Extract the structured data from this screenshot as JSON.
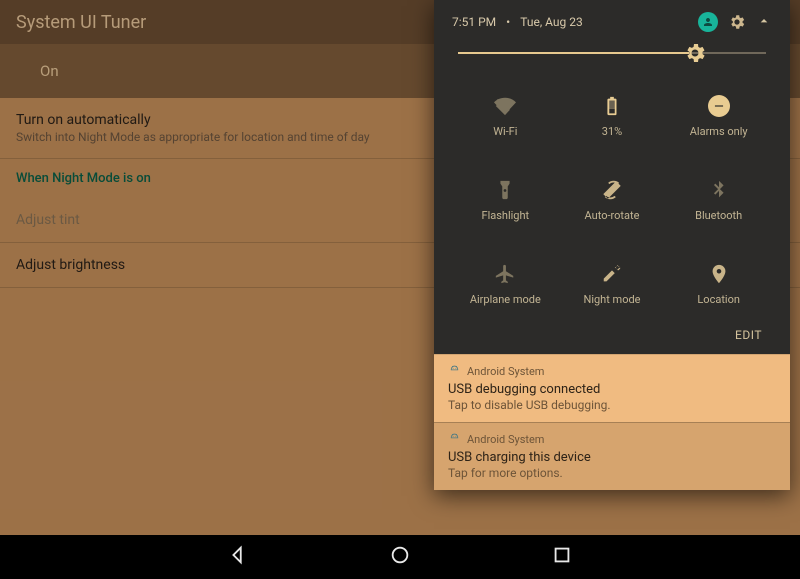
{
  "page": {
    "title": "System UI Tuner",
    "master_switch": "On",
    "items": {
      "auto": {
        "title": "Turn on automatically",
        "subtitle": "Switch into Night Mode as appropriate for location and time of day"
      },
      "section": "When Night Mode is on",
      "tint": {
        "title": "Adjust tint"
      },
      "brightness": {
        "title": "Adjust brightness"
      }
    }
  },
  "shade": {
    "time": "7:51 PM",
    "date": "Tue, Aug 23",
    "separator": "•",
    "brightness_pct": 75,
    "tiles": {
      "wifi": {
        "label": "Wi-Fi"
      },
      "battery": {
        "label": "31%"
      },
      "dnd": {
        "label": "Alarms only"
      },
      "flashlight": {
        "label": "Flashlight"
      },
      "rotate": {
        "label": "Auto-rotate"
      },
      "bluetooth": {
        "label": "Bluetooth"
      },
      "airplane": {
        "label": "Airplane mode"
      },
      "nightmode": {
        "label": "Night mode"
      },
      "location": {
        "label": "Location"
      }
    },
    "edit": "EDIT"
  },
  "notifications": [
    {
      "app": "Android System",
      "title": "USB debugging connected",
      "subtitle": "Tap to disable USB debugging."
    },
    {
      "app": "Android System",
      "title": "USB charging this device",
      "subtitle": "Tap for more options."
    }
  ]
}
